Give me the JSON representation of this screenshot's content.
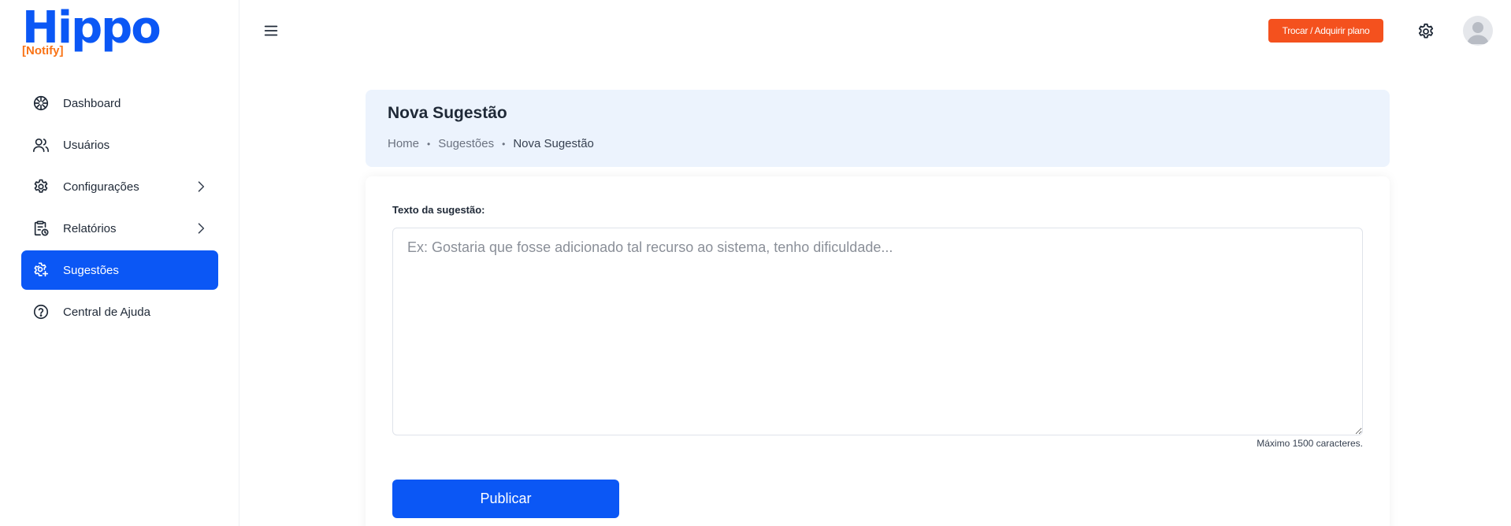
{
  "brand": {
    "name": "Hippo",
    "sub": "[Notify]",
    "primary_color": "#0b57f5",
    "accent_color": "#f97316"
  },
  "sidebar": {
    "items": [
      {
        "label": "Dashboard",
        "icon": "dashboard-icon",
        "active": false,
        "has_submenu": false
      },
      {
        "label": "Usuários",
        "icon": "users-icon",
        "active": false,
        "has_submenu": false
      },
      {
        "label": "Configurações",
        "icon": "gear-icon",
        "active": false,
        "has_submenu": true
      },
      {
        "label": "Relatórios",
        "icon": "clipboard-clock-icon",
        "active": false,
        "has_submenu": true
      },
      {
        "label": "Sugestões",
        "icon": "gear-plus-icon",
        "active": true,
        "has_submenu": false
      },
      {
        "label": "Central de Ajuda",
        "icon": "help-circle-icon",
        "active": false,
        "has_submenu": false
      }
    ]
  },
  "header": {
    "plan_button_label": "Trocar / Adquirir plano",
    "plan_button_color": "#f4511e",
    "settings_icon": "gear-icon",
    "avatar_icon": "user-avatar-icon"
  },
  "page": {
    "title": "Nova Sugestão",
    "breadcrumb": [
      "Home",
      "Sugestões",
      "Nova Sugestão"
    ]
  },
  "form": {
    "label": "Texto da sugestão:",
    "value": "",
    "placeholder": "Ex: Gostaria que fosse adicionado tal recurso ao sistema, tenho dificuldade...",
    "hint": "Máximo 1500 caracteres.",
    "submit_label": "Publicar"
  }
}
